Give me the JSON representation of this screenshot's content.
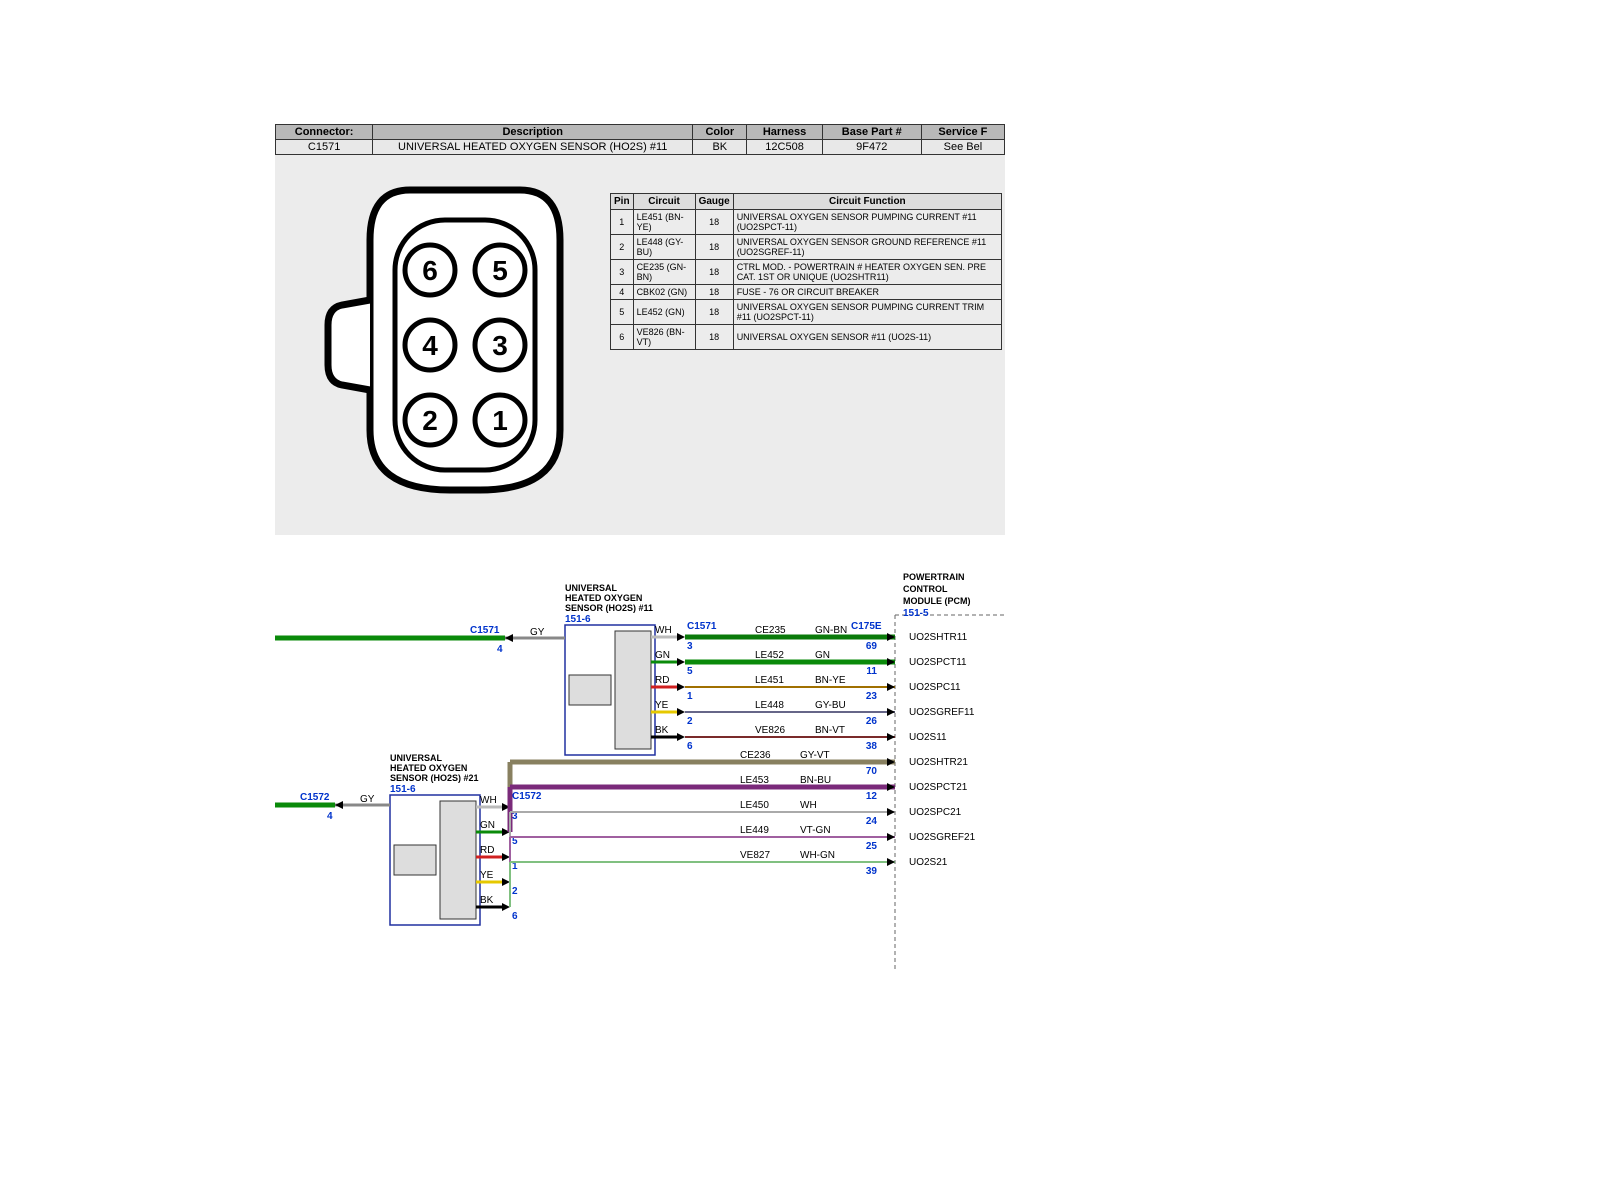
{
  "top_table": {
    "headers": [
      "Connector:",
      "Description",
      "Color",
      "Harness",
      "Base Part #",
      "Service F"
    ],
    "row": {
      "connector": "C1571",
      "description": "UNIVERSAL HEATED OXYGEN SENSOR (HO2S) #11",
      "color": "BK",
      "harness": "12C508",
      "base_part": "9F472",
      "service": "See Bel"
    }
  },
  "connector_pins": [
    "6",
    "5",
    "4",
    "3",
    "2",
    "1"
  ],
  "pin_table": {
    "headers": [
      "Pin",
      "Circuit",
      "Gauge",
      "Circuit Function"
    ],
    "rows": [
      {
        "pin": "1",
        "circuit": "LE451 (BN-YE)",
        "gauge": "18",
        "func": "UNIVERSAL OXYGEN SENSOR PUMPING CURRENT #11 (UO2SPCT-11)"
      },
      {
        "pin": "2",
        "circuit": "LE448 (GY-BU)",
        "gauge": "18",
        "func": "UNIVERSAL OXYGEN SENSOR GROUND REFERENCE #11 (UO2SGREF-11)"
      },
      {
        "pin": "3",
        "circuit": "CE235 (GN-BN)",
        "gauge": "18",
        "func": "CTRL MOD. - POWERTRAIN # HEATER OXYGEN SEN. PRE CAT. 1ST OR UNIQUE (UO2SHTR11)"
      },
      {
        "pin": "4",
        "circuit": "CBK02 (GN)",
        "gauge": "18",
        "func": "FUSE - 76 OR CIRCUIT BREAKER"
      },
      {
        "pin": "5",
        "circuit": "LE452 (GN)",
        "gauge": "18",
        "func": "UNIVERSAL OXYGEN SENSOR PUMPING CURRENT TRIM #11 (UO2SPCT-11)"
      },
      {
        "pin": "6",
        "circuit": "VE826 (BN-VT)",
        "gauge": "18",
        "func": "UNIVERSAL OXYGEN SENSOR #11 (UO2S-11)"
      }
    ]
  },
  "wiring": {
    "sensor11": {
      "title": "UNIVERSAL HEATED OXYGEN SENSOR (HO2S) #11",
      "ref": "151-6",
      "conn": "C1571"
    },
    "sensor21": {
      "title": "UNIVERSAL HEATED OXYGEN SENSOR (HO2S) #21",
      "ref": "151-6",
      "conn": "C1572"
    },
    "pcm": {
      "title": "POWERTRAIN CONTROL MODULE (PCM)",
      "ref": "151-5",
      "conn": "C175E"
    },
    "pin4_left": "4",
    "gy": "GY",
    "wires11": [
      {
        "pin": "3",
        "inner": "WH",
        "circuit": "CE235",
        "color": "GN-BN",
        "pcm_pin": "69",
        "signal": "UO2SHTR11",
        "stroke": "#0a7a0a",
        "thick": true
      },
      {
        "pin": "5",
        "inner": "GN",
        "circuit": "LE452",
        "color": "GN",
        "pcm_pin": "11",
        "signal": "UO2SPCT11",
        "stroke": "#0a8a0a",
        "thick": true
      },
      {
        "pin": "1",
        "inner": "RD",
        "circuit": "LE451",
        "color": "BN-YE",
        "pcm_pin": "23",
        "signal": "UO2SPC11",
        "stroke": "#a07000"
      },
      {
        "pin": "2",
        "inner": "YE",
        "circuit": "LE448",
        "color": "GY-BU",
        "pcm_pin": "26",
        "signal": "UO2SGREF11",
        "stroke": "#666688"
      },
      {
        "pin": "6",
        "inner": "BK",
        "circuit": "VE826",
        "color": "BN-VT",
        "pcm_pin": "38",
        "signal": "UO2S11",
        "stroke": "#7a2a2a"
      }
    ],
    "wires21": [
      {
        "pin": "3",
        "inner": "WH",
        "circuit": "CE236",
        "color": "GY-VT",
        "pcm_pin": "70",
        "signal": "UO2SHTR21",
        "stroke": "#888060",
        "thick": true
      },
      {
        "pin": "5",
        "inner": "GN",
        "circuit": "LE453",
        "color": "BN-BU",
        "pcm_pin": "12",
        "signal": "UO2SPCT21",
        "stroke": "#7a2a7a",
        "thick": true
      },
      {
        "pin": "1",
        "inner": "RD",
        "circuit": "LE450",
        "color": "WH",
        "pcm_pin": "24",
        "signal": "UO2SPC21",
        "stroke": "#aaaaaa"
      },
      {
        "pin": "2",
        "inner": "YE",
        "circuit": "LE449",
        "color": "VT-GN",
        "pcm_pin": "25",
        "signal": "UO2SGREF21",
        "stroke": "#a060a0"
      },
      {
        "pin": "6",
        "inner": "BK",
        "circuit": "VE827",
        "color": "WH-GN",
        "pcm_pin": "39",
        "signal": "UO2S21",
        "stroke": "#80c080"
      }
    ],
    "inner_colors": {
      "WH": "#bbb",
      "GN": "#0a8a0a",
      "RD": "#d02020",
      "YE": "#e6c800",
      "BK": "#000"
    }
  }
}
